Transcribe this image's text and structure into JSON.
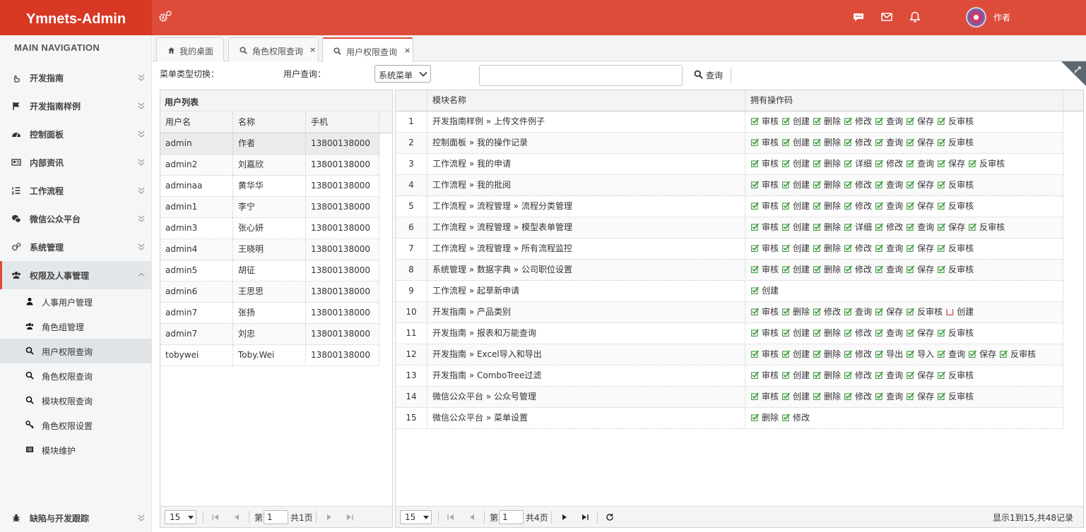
{
  "app": {
    "title": "Ymnets-Admin",
    "user_name": "作者"
  },
  "sidebar": {
    "header": "MAIN NAVIGATION",
    "menus": [
      {
        "label": "开发指南",
        "icon": "hand-pointer-icon"
      },
      {
        "label": "开发指南样例",
        "icon": "flag-icon"
      },
      {
        "label": "控制面板",
        "icon": "dashboard-icon"
      },
      {
        "label": "内部资讯",
        "icon": "newspaper-icon"
      },
      {
        "label": "工作流程",
        "icon": "list-ordered-icon"
      },
      {
        "label": "微信公众平台",
        "icon": "wechat-icon"
      },
      {
        "label": "系统管理",
        "icon": "cogs-icon"
      },
      {
        "label": "权限及人事管理",
        "icon": "users-icon"
      }
    ],
    "submenus": [
      {
        "label": "人事用户管理",
        "icon": "user-icon"
      },
      {
        "label": "角色组管理",
        "icon": "users-icon"
      },
      {
        "label": "用户权限查询",
        "icon": "search-icon"
      },
      {
        "label": "角色权限查询",
        "icon": "search-icon"
      },
      {
        "label": "模块权限查询",
        "icon": "search-icon"
      },
      {
        "label": "角色权限设置",
        "icon": "key-icon"
      },
      {
        "label": "模块维护",
        "icon": "list-icon"
      }
    ],
    "bottom": {
      "label": "缺陷与开发跟踪",
      "icon": "bug-icon"
    }
  },
  "tabs": [
    {
      "label": "我的桌面",
      "icon": "home-icon"
    },
    {
      "label": "角色权限查询",
      "icon": "search-icon"
    },
    {
      "label": "用户权限查询",
      "icon": "search-icon"
    }
  ],
  "toolbar": {
    "menu_type_label": "菜单类型切换：",
    "menu_type_value": "系统菜单",
    "user_query_label": "用户查询：",
    "user_query_value": "",
    "search_label": "查询"
  },
  "user_grid": {
    "title": "用户列表",
    "columns": [
      "用户名",
      "名称",
      "手机"
    ],
    "rows": [
      [
        "admin",
        "作者",
        "13800138000"
      ],
      [
        "admin2",
        "刘嘉欣",
        "13800138000"
      ],
      [
        "adminaa",
        "黄华华",
        "13800138000"
      ],
      [
        "admin1",
        "李宁",
        "13800138000"
      ],
      [
        "admin3",
        "张心妍",
        "13800138000"
      ],
      [
        "admin4",
        "王晓明",
        "13800138000"
      ],
      [
        "admin5",
        "胡征",
        "13800138000"
      ],
      [
        "admin6",
        "王思思",
        "13800138000"
      ],
      [
        "admin7",
        "张扬",
        "13800138000"
      ],
      [
        "admin7",
        "刘忠",
        "13800138000"
      ],
      [
        "tobywei",
        "Toby.Wei",
        "13800138000"
      ]
    ],
    "pager": {
      "page_size": "15",
      "page_prefix": "第",
      "page_value": "1",
      "page_total": "共1页"
    }
  },
  "perm_grid": {
    "columns": [
      "模块名称",
      "拥有操作码"
    ],
    "rows": [
      {
        "no": "1",
        "module": "开发指南样例 » 上传文件例子",
        "ops": [
          [
            "审核",
            true
          ],
          [
            "创建",
            true
          ],
          [
            "删除",
            true
          ],
          [
            "修改",
            true
          ],
          [
            "查询",
            true
          ],
          [
            "保存",
            true
          ],
          [
            "反审核",
            true
          ]
        ]
      },
      {
        "no": "2",
        "module": "控制面板 » 我的操作记录",
        "ops": [
          [
            "审核",
            true
          ],
          [
            "创建",
            true
          ],
          [
            "删除",
            true
          ],
          [
            "修改",
            true
          ],
          [
            "查询",
            true
          ],
          [
            "保存",
            true
          ],
          [
            "反审核",
            true
          ]
        ]
      },
      {
        "no": "3",
        "module": "工作流程 » 我的申请",
        "ops": [
          [
            "审核",
            true
          ],
          [
            "创建",
            true
          ],
          [
            "删除",
            true
          ],
          [
            "详细",
            true
          ],
          [
            "修改",
            true
          ],
          [
            "查询",
            true
          ],
          [
            "保存",
            true
          ],
          [
            "反审核",
            true
          ]
        ]
      },
      {
        "no": "4",
        "module": "工作流程 » 我的批阅",
        "ops": [
          [
            "审核",
            true
          ],
          [
            "创建",
            true
          ],
          [
            "删除",
            true
          ],
          [
            "修改",
            true
          ],
          [
            "查询",
            true
          ],
          [
            "保存",
            true
          ],
          [
            "反审核",
            true
          ]
        ]
      },
      {
        "no": "5",
        "module": "工作流程 » 流程管理 » 流程分类管理",
        "ops": [
          [
            "审核",
            true
          ],
          [
            "创建",
            true
          ],
          [
            "删除",
            true
          ],
          [
            "修改",
            true
          ],
          [
            "查询",
            true
          ],
          [
            "保存",
            true
          ],
          [
            "反审核",
            true
          ]
        ]
      },
      {
        "no": "6",
        "module": "工作流程 » 流程管理 » 模型表单管理",
        "ops": [
          [
            "审核",
            true
          ],
          [
            "创建",
            true
          ],
          [
            "删除",
            true
          ],
          [
            "详细",
            true
          ],
          [
            "修改",
            true
          ],
          [
            "查询",
            true
          ],
          [
            "保存",
            true
          ],
          [
            "反审核",
            true
          ]
        ]
      },
      {
        "no": "7",
        "module": "工作流程 » 流程管理 » 所有流程监控",
        "ops": [
          [
            "审核",
            true
          ],
          [
            "创建",
            true
          ],
          [
            "删除",
            true
          ],
          [
            "修改",
            true
          ],
          [
            "查询",
            true
          ],
          [
            "保存",
            true
          ],
          [
            "反审核",
            true
          ]
        ]
      },
      {
        "no": "8",
        "module": "系统管理 » 数据字典 » 公司职位设置",
        "ops": [
          [
            "审核",
            true
          ],
          [
            "创建",
            true
          ],
          [
            "删除",
            true
          ],
          [
            "修改",
            true
          ],
          [
            "查询",
            true
          ],
          [
            "保存",
            true
          ],
          [
            "反审核",
            true
          ]
        ]
      },
      {
        "no": "9",
        "module": "工作流程 » 起草新申请",
        "ops": [
          [
            "创建",
            true
          ]
        ]
      },
      {
        "no": "10",
        "module": "开发指南 » 产品类别",
        "ops": [
          [
            "审核",
            true
          ],
          [
            "删除",
            true
          ],
          [
            "修改",
            true
          ],
          [
            "查询",
            true
          ],
          [
            "保存",
            true
          ],
          [
            "反审核",
            true
          ],
          [
            "创建",
            false
          ]
        ]
      },
      {
        "no": "11",
        "module": "开发指南 » 报表和万能查询",
        "ops": [
          [
            "审核",
            true
          ],
          [
            "创建",
            true
          ],
          [
            "删除",
            true
          ],
          [
            "修改",
            true
          ],
          [
            "查询",
            true
          ],
          [
            "保存",
            true
          ],
          [
            "反审核",
            true
          ]
        ]
      },
      {
        "no": "12",
        "module": "开发指南 » Excel导入和导出",
        "ops": [
          [
            "审核",
            true
          ],
          [
            "创建",
            true
          ],
          [
            "删除",
            true
          ],
          [
            "修改",
            true
          ],
          [
            "导出",
            true
          ],
          [
            "导入",
            true
          ],
          [
            "查询",
            true
          ],
          [
            "保存",
            true
          ],
          [
            "反审核",
            true
          ]
        ]
      },
      {
        "no": "13",
        "module": "开发指南 » ComboTree过滤",
        "ops": [
          [
            "审核",
            true
          ],
          [
            "创建",
            true
          ],
          [
            "删除",
            true
          ],
          [
            "修改",
            true
          ],
          [
            "查询",
            true
          ],
          [
            "保存",
            true
          ],
          [
            "反审核",
            true
          ]
        ]
      },
      {
        "no": "14",
        "module": "微信公众平台 » 公众号管理",
        "ops": [
          [
            "审核",
            true
          ],
          [
            "创建",
            true
          ],
          [
            "删除",
            true
          ],
          [
            "修改",
            true
          ],
          [
            "查询",
            true
          ],
          [
            "保存",
            true
          ],
          [
            "反审核",
            true
          ]
        ]
      },
      {
        "no": "15",
        "module": "微信公众平台 » 菜单设置",
        "ops": [
          [
            "删除",
            true
          ],
          [
            "修改",
            true
          ]
        ]
      }
    ],
    "pager": {
      "page_size": "15",
      "page_prefix": "第",
      "page_value": "1",
      "page_total": "共4页",
      "summary": "显示1到15,共48记录"
    }
  },
  "colors": {
    "brand": "#dd4b39",
    "brand_dark": "#d73925",
    "check_green": "#3c9a3c",
    "uncheck_red": "#d9534f"
  }
}
